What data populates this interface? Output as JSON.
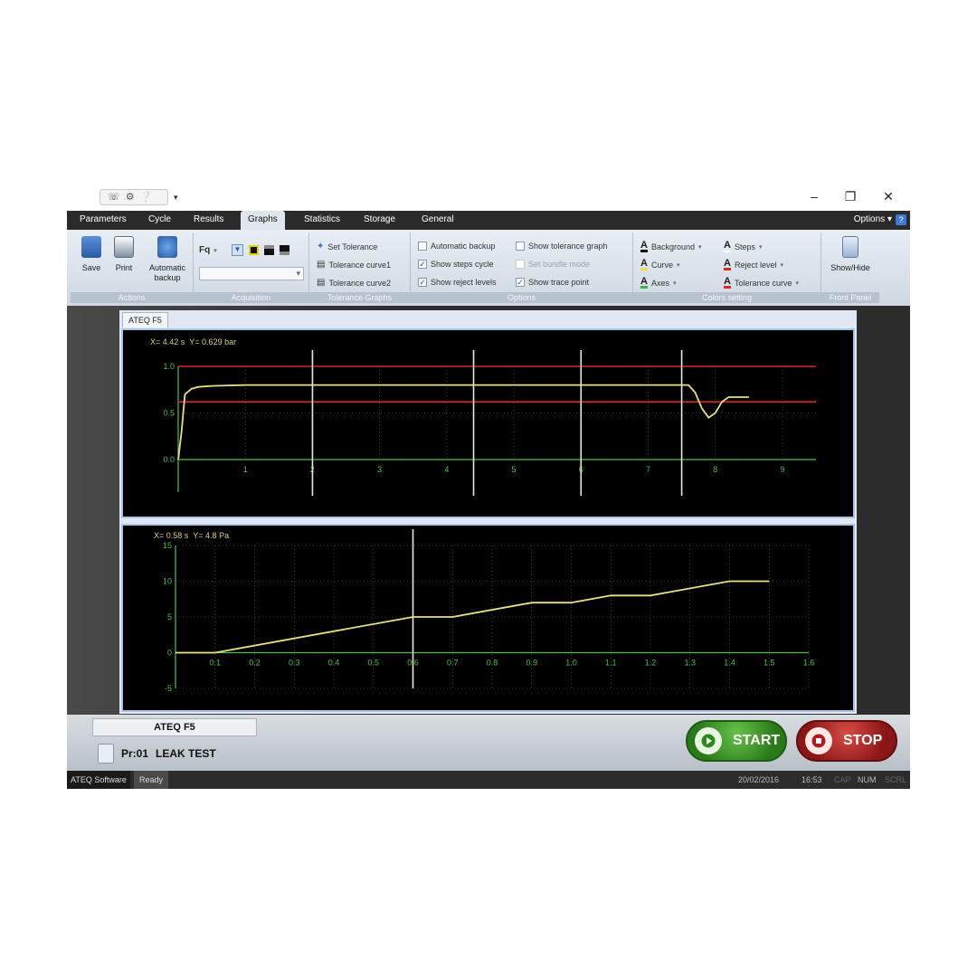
{
  "titlebar": {
    "minimize": "–",
    "maximize": "❐",
    "close": "✕"
  },
  "tabs": [
    {
      "label": "Parameters"
    },
    {
      "label": "Cycle"
    },
    {
      "label": "Results"
    },
    {
      "label": "Graphs",
      "active": true
    },
    {
      "label": "Statistics"
    },
    {
      "label": "Storage"
    },
    {
      "label": "General"
    }
  ],
  "options_label": "Options",
  "ribbon": {
    "actions": {
      "label": "Actions",
      "save": "Save",
      "print": "Print",
      "auto_backup_line1": "Automatic",
      "auto_backup_line2": "backup"
    },
    "acquisition": {
      "label": "Acquisition",
      "fq": "Fq"
    },
    "tolerance": {
      "label": "Tolerance Graphs",
      "set_tolerance": "Set Tolerance",
      "curve1": "Tolerance curve1",
      "curve2": "Tolerance curve2"
    },
    "options": {
      "label": "Options",
      "automatic_backup": {
        "text": "Automatic backup",
        "checked": false
      },
      "show_steps_cycle": {
        "text": "Show steps cycle",
        "checked": true
      },
      "show_reject_levels": {
        "text": "Show reject levels",
        "checked": true
      },
      "show_tolerance_graph": {
        "text": "Show tolerance graph",
        "checked": false
      },
      "set_bundle_mode": {
        "text": "Set bundle mode",
        "checked": false
      },
      "show_trace_point": {
        "text": "Show trace point",
        "checked": true
      }
    },
    "colors": {
      "label": "Colors setting",
      "background": "Background",
      "curve": "Curve",
      "axes": "Axes",
      "steps": "Steps",
      "reject_level": "Reject level",
      "tolerance_curve": "Tolerance curve"
    },
    "front_panel": {
      "label": "Front Panel",
      "show_hide": "Show/Hide"
    }
  },
  "document_tab": "ATEQ F5",
  "top_chart_readout": {
    "x": "X=  4.42 s",
    "y": "Y=  0.629 bar"
  },
  "bottom_chart_readout": {
    "x": "X=  0.58 s",
    "y": "Y=  4.8 Pa"
  },
  "chart_data": [
    {
      "type": "line",
      "title": "",
      "xlabel": "",
      "ylabel": "",
      "xlim": [
        0,
        9.5
      ],
      "ylim": [
        0,
        1.0
      ],
      "xticks": [
        1,
        2,
        3,
        4,
        5,
        6,
        7,
        8,
        9
      ],
      "yticks": [
        0.0,
        0.5,
        1.0
      ],
      "ytick_labels": [
        "0.0",
        "0.5",
        "1.0"
      ],
      "grid": true,
      "colors": {
        "curve": "#e8e082",
        "reject": "#d92a1e",
        "axes": "#4fbf4f",
        "steps": "#e8e8e8"
      },
      "series": [
        {
          "x": [
            0,
            0.05,
            0.1,
            0.2,
            0.3,
            0.5,
            1.0,
            2.0,
            4.0,
            6.0,
            7.6,
            7.7,
            7.8,
            7.9,
            8.0,
            8.1,
            8.2,
            8.5
          ],
          "y": [
            0.0,
            0.3,
            0.7,
            0.76,
            0.78,
            0.79,
            0.8,
            0.8,
            0.8,
            0.8,
            0.8,
            0.72,
            0.55,
            0.45,
            0.5,
            0.62,
            0.67,
            0.67
          ]
        }
      ],
      "reject_levels": [
        1.0,
        0.62
      ],
      "step_markers": [
        2.0,
        4.4,
        6.0,
        7.5
      ]
    },
    {
      "type": "line",
      "title": "",
      "xlabel": "",
      "ylabel": "",
      "xlim": [
        0,
        1.6
      ],
      "ylim": [
        -5,
        15
      ],
      "xticks": [
        0.1,
        0.2,
        0.3,
        0.4,
        0.5,
        0.6,
        0.7,
        0.8,
        0.9,
        1.0,
        1.1,
        1.2,
        1.3,
        1.4,
        1.5,
        1.6
      ],
      "xtick_labels": [
        "0.1",
        "0.2",
        "0.3",
        "0.4",
        "0.5",
        "0.6",
        "0.7",
        "0.8",
        "0.9",
        "1.0",
        "1.1",
        "1.2",
        "1.3",
        "1.4",
        "1.5",
        "1.6"
      ],
      "yticks": [
        -5,
        0,
        5,
        10,
        15
      ],
      "ytick_labels": [
        "-5",
        "0",
        "5",
        "10",
        "15"
      ],
      "grid": true,
      "colors": {
        "curve": "#e8e082",
        "axes": "#4fbf4f",
        "steps": "#e8e8e8"
      },
      "series": [
        {
          "x": [
            0,
            0.1,
            0.6,
            0.7,
            0.9,
            1.0,
            1.1,
            1.2,
            1.3,
            1.4,
            1.5
          ],
          "y": [
            0,
            0,
            5,
            5,
            7,
            7,
            8,
            8,
            9,
            10,
            10
          ]
        }
      ],
      "step_markers": [
        0.6
      ]
    }
  ],
  "bottom_panel": {
    "device_tab": "ATEQ F5",
    "program_id": "Pr:01",
    "program_name": "LEAK TEST",
    "start_label": "START",
    "stop_label": "STOP"
  },
  "statusbar": {
    "app": "ATEQ Software",
    "status": "Ready",
    "date": "20/02/2016",
    "time": "16:53",
    "caps": "CAP",
    "num": "NUM",
    "scrl": "SCRL"
  }
}
